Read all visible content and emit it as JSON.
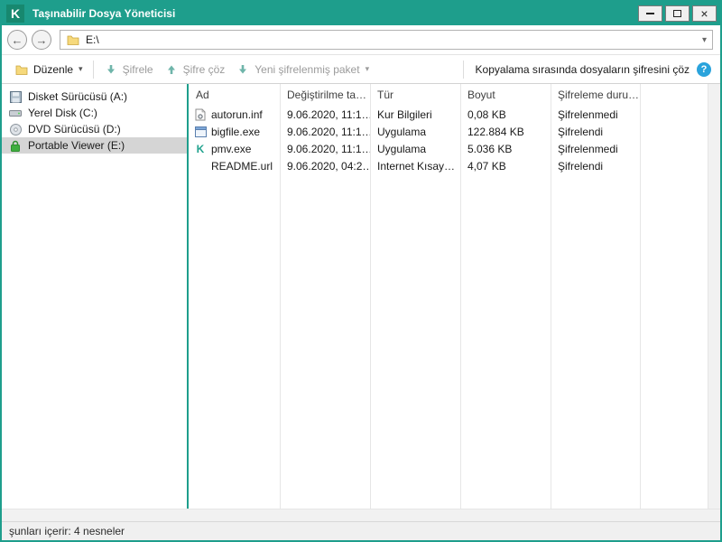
{
  "window": {
    "title": "Taşınabilir Dosya Yöneticisi"
  },
  "colors": {
    "accent": "#1e9e8c",
    "info_blue": "#2aa3dc",
    "lock_green": "#3fae3f",
    "selected_bg": "#d5d5d5",
    "disabled_text": "#9b9b9b"
  },
  "icons": {
    "chevron_down": "▾",
    "arrow_left": "←",
    "arrow_right": "→",
    "close": "×",
    "question": "?",
    "logo_k": "K",
    "kaspersky_k": "K"
  },
  "address_bar": {
    "path": "E:\\"
  },
  "toolbar": {
    "edit_label": "Düzenle",
    "encrypt_label": "Şifrele",
    "decrypt_label": "Şifre çöz",
    "new_package_label": "Yeni şifrelenmiş paket",
    "decrypt_on_copy_label": "Kopyalama sırasında dosyaların şifresini çöz"
  },
  "sidebar": {
    "items": [
      {
        "label": "Disket Sürücüsü (A:)",
        "icon": "floppy-icon",
        "selected": false
      },
      {
        "label": "Yerel Disk (C:)",
        "icon": "harddrive-icon",
        "selected": false
      },
      {
        "label": "DVD Sürücüsü (D:)",
        "icon": "dvd-icon",
        "selected": false
      },
      {
        "label": "Portable Viewer (E:)",
        "icon": "lock-icon",
        "selected": true
      }
    ]
  },
  "file_list": {
    "columns": [
      "Ad",
      "Değiştirilme ta…",
      "Tür",
      "Boyut",
      "Şifreleme duru…"
    ],
    "rows": [
      {
        "name": "autorun.inf",
        "modified": "9.06.2020, 11:1…",
        "type": "Kur Bilgileri",
        "size": "0,08 KB",
        "status": "Şifrelenmedi"
      },
      {
        "name": "bigfile.exe",
        "modified": "9.06.2020, 11:1…",
        "type": "Uygulama",
        "size": "122.884 KB",
        "status": "Şifrelendi"
      },
      {
        "name": "pmv.exe",
        "modified": "9.06.2020, 11:1…",
        "type": "Uygulama",
        "size": "5.036 KB",
        "status": "Şifrelenmedi"
      },
      {
        "name": "README.url",
        "modified": "9.06.2020, 04:2…",
        "type": "Internet Kısay…",
        "size": "4,07 KB",
        "status": "Şifrelendi"
      }
    ]
  },
  "status_bar": {
    "text": "şunları içerir: 4 nesneler"
  }
}
